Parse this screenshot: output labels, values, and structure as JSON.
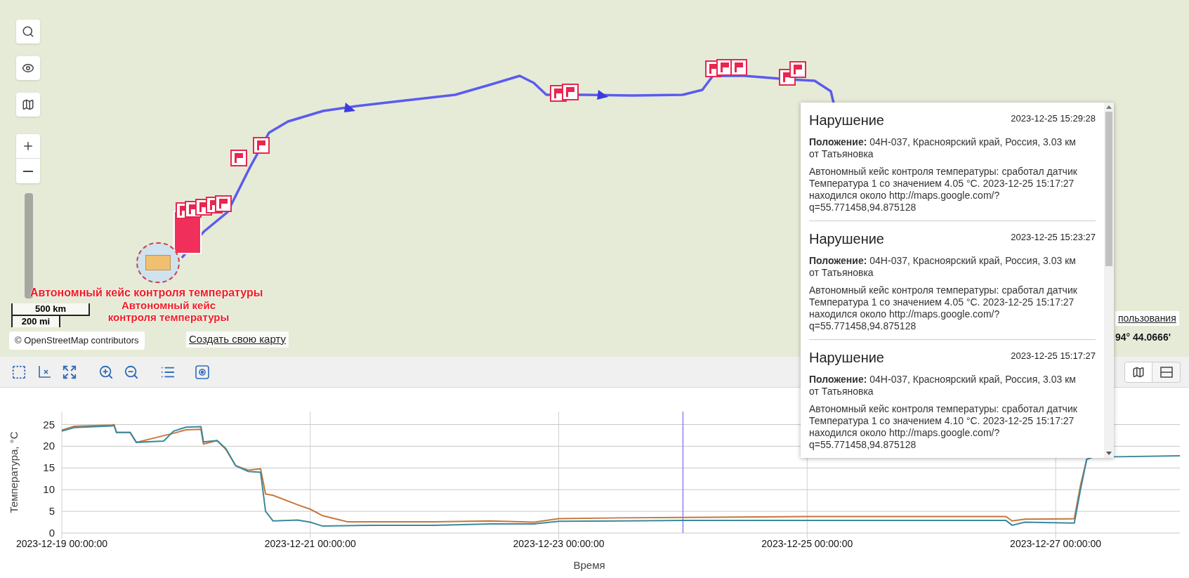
{
  "map": {
    "object_labels": [
      "Автономный кейс контроля температуры",
      "Автономный кейс контроля температуры"
    ],
    "scale": {
      "metric": "500 km",
      "imperial": "200 mi"
    },
    "attribution": "© OpenStreetMap contributors",
    "create_map_link": "Создать свою карту",
    "terms_link": "пользования",
    "coordinates": "94° 44.0666'"
  },
  "popup": {
    "items": [
      {
        "title": "Нарушение",
        "time": "2023-12-25 15:29:28",
        "position_label": "Положение:",
        "position": "04H-037, Красноярский край, Россия, 3.03 км от Татьяновка",
        "message": "Автономный кейс контроля температуры: сработал датчик Температура 1 со значением 4.05 °C. 2023-12-25 15:17:27 находился около http://maps.google.com/?q=55.771458,94.875128"
      },
      {
        "title": "Нарушение",
        "time": "2023-12-25 15:23:27",
        "position_label": "Положение:",
        "position": "04H-037, Красноярский край, Россия, 3.03 км от Татьяновка",
        "message": "Автономный кейс контроля температуры: сработал датчик Температура 1 со значением 4.05 °C. 2023-12-25 15:17:27 находился около http://maps.google.com/?q=55.771458,94.875128"
      },
      {
        "title": "Нарушение",
        "time": "2023-12-25 15:17:27",
        "position_label": "Положение:",
        "position": "04H-037, Красноярский край, Россия, 3.03 км от Татьяновка",
        "message": "Автономный кейс контроля температуры: сработал датчик Температура 1 со значением 4.10 °C. 2023-12-25 15:17:27 находился около http://maps.google.com/?q=55.771458,94.875128"
      }
    ]
  },
  "chart": {
    "chart_data": {
      "type": "line",
      "xlabel": "Время",
      "ylabel": "Температура, °C",
      "x": [
        "2023-12-19 00:00",
        "2023-12-19 02:24",
        "2023-12-19 09:36",
        "2023-12-19 10:05",
        "2023-12-19 10:34",
        "2023-12-19 13:12",
        "2023-12-19 14:24",
        "2023-12-19 19:41",
        "2023-12-19 21:36",
        "2023-12-20 00:00",
        "2023-12-20 02:53",
        "2023-12-20 03:22",
        "2023-12-20 06:00",
        "2023-12-20 07:41",
        "2023-12-20 09:36",
        "2023-12-20 12:00",
        "2023-12-20 14:24",
        "2023-12-20 15:22",
        "2023-12-20 16:48",
        "2023-12-20 21:36",
        "2023-12-21 00:00",
        "2023-12-21 02:24",
        "2023-12-21 07:12",
        "2023-12-21 12:00",
        "2023-12-22 00:00",
        "2023-12-22 10:48",
        "2023-12-22 19:12",
        "2023-12-23 00:00",
        "2023-12-23 12:00",
        "2023-12-24 00:00",
        "2023-12-25 00:00",
        "2023-12-26 00:00",
        "2023-12-26 14:24",
        "2023-12-26 15:36",
        "2023-12-26 18:00",
        "2023-12-27 03:36",
        "2023-12-27 04:48",
        "2023-12-27 06:00",
        "2023-12-27 07:12",
        "2023-12-28 00:00"
      ],
      "series": [
        {
          "color": "#c8773a",
          "values": [
            23.7,
            24.6,
            24.9,
            25,
            23.2,
            23.2,
            20.9,
            null,
            23,
            23.8,
            23.9,
            20.5,
            21.3,
            19.3,
            15.5,
            14.5,
            14.8,
            9,
            8.7,
            6.5,
            5.5,
            4,
            2.6,
            2.6,
            2.6,
            2.8,
            2.5,
            3.3,
            3.5,
            3.6,
            3.8,
            3.8,
            3.8,
            2.8,
            3.2,
            3.3,
            11,
            17,
            null,
            null
          ]
        },
        {
          "color": "#3a8a9e",
          "values": [
            23.5,
            24.3,
            24.7,
            24.8,
            23.2,
            23.2,
            20.9,
            21.2,
            23.5,
            24.4,
            24.5,
            21,
            21.3,
            19.5,
            15.5,
            14.2,
            14.0,
            5,
            2.8,
            3.0,
            2.5,
            1.6,
            1.7,
            1.8,
            1.8,
            2.1,
            2.1,
            2.7,
            2.8,
            2.9,
            2.9,
            2.9,
            2.9,
            1.8,
            2.5,
            2.3,
            10,
            17,
            17.5,
            17.8
          ]
        }
      ],
      "grid": true,
      "xlim": [
        "2023-12-19 00:00:00",
        "2023-12-28 00:00:00"
      ],
      "ylim": [
        0,
        28
      ],
      "xticks": [
        "2023-12-19 00:00:00",
        "2023-12-21 00:00:00",
        "2023-12-23 00:00:00",
        "2023-12-25 00:00:00",
        "2023-12-27 00:00:00"
      ],
      "yticks": [
        0,
        5,
        10,
        15,
        20,
        25
      ],
      "ref_lines": [
        {
          "axis": "x",
          "value": "2023-12-24 00:00:00"
        }
      ]
    }
  }
}
